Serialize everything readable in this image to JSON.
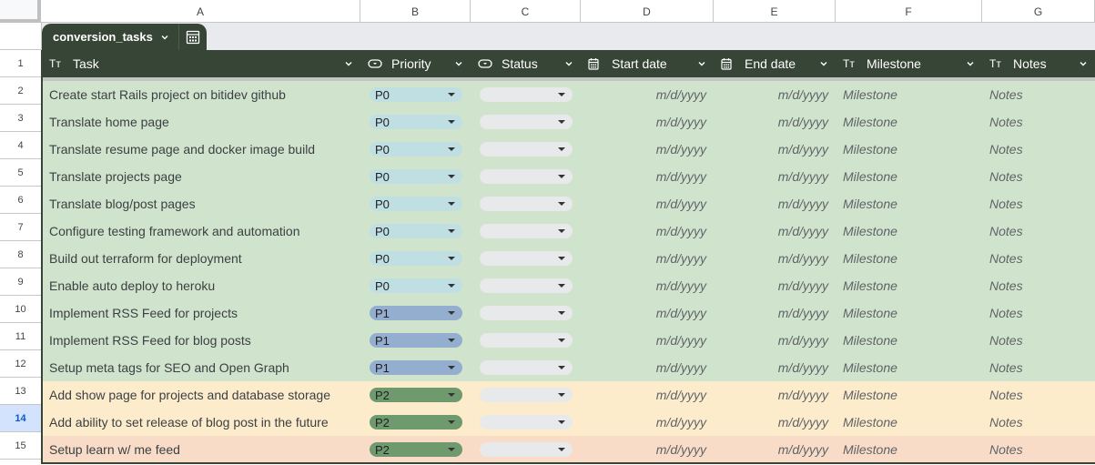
{
  "columns": [
    "A",
    "B",
    "C",
    "D",
    "E",
    "F",
    "G"
  ],
  "table": {
    "name": "conversion_tasks",
    "headers": [
      {
        "label": "Task",
        "icon": "text-type-icon"
      },
      {
        "label": "Priority",
        "icon": "dropdown-chip-icon"
      },
      {
        "label": "Status",
        "icon": "dropdown-chip-icon"
      },
      {
        "label": "Start date",
        "icon": "calendar-icon"
      },
      {
        "label": "End date",
        "icon": "calendar-icon"
      },
      {
        "label": "Milestone",
        "icon": "text-type-icon"
      },
      {
        "label": "Notes",
        "icon": "text-type-icon"
      }
    ],
    "text_type_glyph": "Tт",
    "selected_row": "14",
    "rows": [
      {
        "num": "2",
        "task": "Create start Rails project on bitidev github",
        "priority": "P0",
        "status": "",
        "start": "m/d/yyyy",
        "end": "m/d/yyyy",
        "milestone": "Milestone",
        "notes": "Notes",
        "color": "green"
      },
      {
        "num": "3",
        "task": "Translate home page",
        "priority": "P0",
        "status": "",
        "start": "m/d/yyyy",
        "end": "m/d/yyyy",
        "milestone": "Milestone",
        "notes": "Notes",
        "color": "green"
      },
      {
        "num": "4",
        "task": "Translate resume page and docker image build",
        "priority": "P0",
        "status": "",
        "start": "m/d/yyyy",
        "end": "m/d/yyyy",
        "milestone": "Milestone",
        "notes": "Notes",
        "color": "green"
      },
      {
        "num": "5",
        "task": "Translate projects page",
        "priority": "P0",
        "status": "",
        "start": "m/d/yyyy",
        "end": "m/d/yyyy",
        "milestone": "Milestone",
        "notes": "Notes",
        "color": "green"
      },
      {
        "num": "6",
        "task": "Translate blog/post pages",
        "priority": "P0",
        "status": "",
        "start": "m/d/yyyy",
        "end": "m/d/yyyy",
        "milestone": "Milestone",
        "notes": "Notes",
        "color": "green"
      },
      {
        "num": "7",
        "task": "Configure testing framework and automation",
        "priority": "P0",
        "status": "",
        "start": "m/d/yyyy",
        "end": "m/d/yyyy",
        "milestone": "Milestone",
        "notes": "Notes",
        "color": "green"
      },
      {
        "num": "8",
        "task": "Build out terraform for deployment",
        "priority": "P0",
        "status": "",
        "start": "m/d/yyyy",
        "end": "m/d/yyyy",
        "milestone": "Milestone",
        "notes": "Notes",
        "color": "green"
      },
      {
        "num": "9",
        "task": "Enable auto deploy to heroku",
        "priority": "P0",
        "status": "",
        "start": "m/d/yyyy",
        "end": "m/d/yyyy",
        "milestone": "Milestone",
        "notes": "Notes",
        "color": "green"
      },
      {
        "num": "10",
        "task": "Implement RSS Feed for projects",
        "priority": "P1",
        "status": "",
        "start": "m/d/yyyy",
        "end": "m/d/yyyy",
        "milestone": "Milestone",
        "notes": "Notes",
        "color": "green"
      },
      {
        "num": "11",
        "task": "Implement RSS Feed for blog posts",
        "priority": "P1",
        "status": "",
        "start": "m/d/yyyy",
        "end": "m/d/yyyy",
        "milestone": "Milestone",
        "notes": "Notes",
        "color": "green"
      },
      {
        "num": "12",
        "task": "Setup meta tags for SEO and Open Graph",
        "priority": "P1",
        "status": "",
        "start": "m/d/yyyy",
        "end": "m/d/yyyy",
        "milestone": "Milestone",
        "notes": "Notes",
        "color": "green"
      },
      {
        "num": "13",
        "task": "Add show page for projects and database storage",
        "priority": "P2",
        "status": "",
        "start": "m/d/yyyy",
        "end": "m/d/yyyy",
        "milestone": "Milestone",
        "notes": "Notes",
        "color": "yellow"
      },
      {
        "num": "14",
        "task": "Add ability to set release of blog post in the future",
        "priority": "P2",
        "status": "",
        "start": "m/d/yyyy",
        "end": "m/d/yyyy",
        "milestone": "Milestone",
        "notes": "Notes",
        "color": "yellow"
      },
      {
        "num": "15",
        "task": "Setup learn w/ me feed",
        "priority": "P2",
        "status": "",
        "start": "m/d/yyyy",
        "end": "m/d/yyyy",
        "milestone": "Milestone",
        "notes": "Notes",
        "color": "orange"
      }
    ]
  },
  "header_row_num": "1",
  "colors": {
    "header_bg": "#364536",
    "row_green": "#d0e4cd",
    "row_yellow": "#fdeccb",
    "row_orange": "#f9dcc7",
    "chip_p0": "#c0dfe2",
    "chip_p1": "#94aed0",
    "chip_p2": "#6f9a6d",
    "chip_empty": "#e8e9ea",
    "selection": "#d3e3fd"
  }
}
